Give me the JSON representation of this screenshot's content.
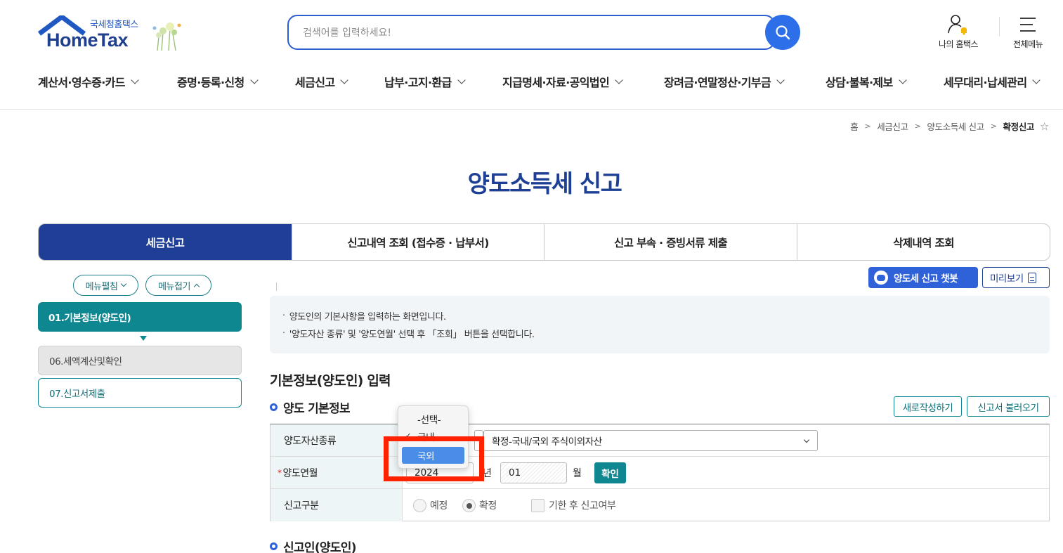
{
  "header": {
    "logo_sub": "국세청홈택스",
    "logo_main": "HomeTax",
    "search_placeholder": "검색어를 입력하세요!",
    "my_hometax": "나의 홈택스",
    "all_menu": "전체메뉴"
  },
  "gnb": [
    "계산서·영수증·카드",
    "증명·등록·신청",
    "세금신고",
    "납부·고지·환급",
    "지급명세·자료·공익법인",
    "장려금·연말정산·기부금",
    "상담·불복·제보",
    "세무대리·납세관리"
  ],
  "breadcrumb": {
    "home": "홈",
    "level1": "세금신고",
    "level2": "양도소득세 신고",
    "current": "확정신고"
  },
  "page_title": "양도소득세 신고",
  "tabs": [
    "세금신고",
    "신고내역 조회 (접수증 · 납부서)",
    "신고 부속 · 증빙서류 제출",
    "삭제내역 조회"
  ],
  "side": {
    "expand_label": "메뉴펼침",
    "collapse_label": "메뉴접기",
    "steps": [
      "01.기본정보(양도인)",
      "06.세액계산및확인",
      "07.신고서제출"
    ]
  },
  "actions": {
    "chatbot": "양도세 신고 챗봇",
    "preview": "미리보기"
  },
  "notice": [
    "양도인의 기본사항을 입력하는 화면입니다.",
    "'양도자산 종류' 및 '양도연월' 선택 후 「조회」 버튼을 선택합니다."
  ],
  "form": {
    "section_title": "기본정보(양도인) 입력",
    "sub_title": "양도 기본정보",
    "new_button": "새로작성하기",
    "load_button": "신고서 불러오기",
    "asset_type_label": "양도자산종류",
    "asset_kind_value": "확정-국내/국외 주식이외자산",
    "month_label": "양도연월",
    "year_value": "2024",
    "year_unit": "년",
    "month_value": "01",
    "month_unit": "월",
    "confirm_button": "확인",
    "report_type_label": "신고구분",
    "radio_prelim": "예정",
    "radio_final": "확정",
    "late_check": "기한 후 신고여부",
    "next_section": "신고인(양도인)"
  },
  "dropdown": {
    "options": [
      "-선택-",
      "국내",
      "국외"
    ],
    "checked": "국내",
    "hover": "국외"
  },
  "colors": {
    "brand_navy": "#1f3f96",
    "teal": "#0e8790",
    "search_blue": "#2d6fe8",
    "highlight_red": "#ff2200"
  }
}
